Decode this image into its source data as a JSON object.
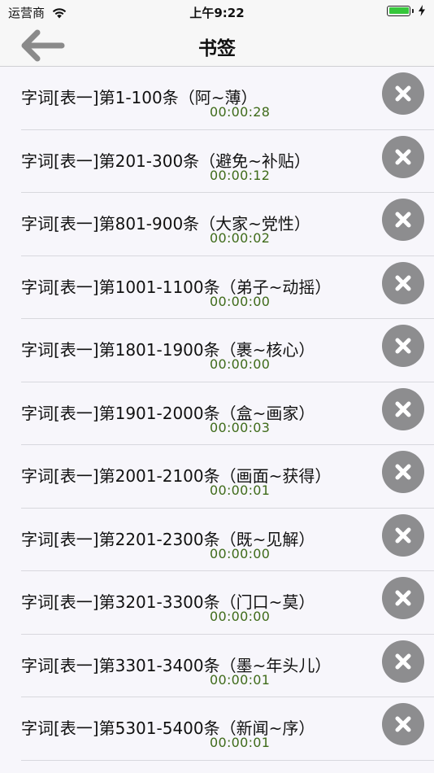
{
  "status_bar": {
    "carrier": "运营商",
    "time": "上午9:22",
    "battery_level_percent": 100
  },
  "nav": {
    "back_icon": "arrow-left-icon",
    "title": "书签"
  },
  "bookmarks": [
    {
      "title": "字词[表一]第1-100条（阿~薄）",
      "time": "00:00:28"
    },
    {
      "title": "字词[表一]第201-300条（避免~补贴）",
      "time": "00:00:12"
    },
    {
      "title": "字词[表一]第801-900条（大家~党性）",
      "time": "00:00:02"
    },
    {
      "title": "字词[表一]第1001-1100条（弟子~动摇）",
      "time": "00:00:00"
    },
    {
      "title": "字词[表一]第1801-1900条（裹~核心）",
      "time": "00:00:00"
    },
    {
      "title": "字词[表一]第1901-2000条（盒~画家）",
      "time": "00:00:03"
    },
    {
      "title": "字词[表一]第2001-2100条（画面~获得）",
      "time": "00:00:01"
    },
    {
      "title": "字词[表一]第2201-2300条（既~见解）",
      "time": "00:00:00"
    },
    {
      "title": "字词[表一]第3201-3300条（门口~莫）",
      "time": "00:00:00"
    },
    {
      "title": "字词[表一]第3301-3400条（墨~年头儿）",
      "time": "00:00:01"
    },
    {
      "title": "字词[表一]第5301-5400条（新闻~序）",
      "time": "00:00:01"
    }
  ],
  "colors": {
    "time_text": "#3f6b1a",
    "delete_button_bg": "#8d8d8f",
    "battery_fill": "#36c73b"
  }
}
